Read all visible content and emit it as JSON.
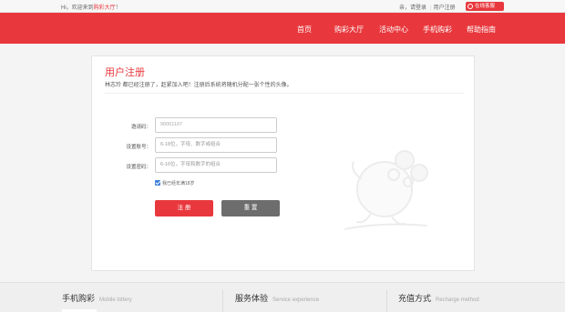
{
  "topbar": {
    "welcome": "Hi，欢迎来到",
    "hall_link": "购彩大厅",
    "welcome_end": "！",
    "login_prefix": "亲，请登录",
    "register": "用户注册",
    "service": "在线客服"
  },
  "nav": {
    "items": [
      "首页",
      "购彩大厅",
      "活动中心",
      "手机购彩",
      "帮助指南"
    ]
  },
  "panel": {
    "title": "用户注册",
    "subtitle": "林志玲 都已经注册了，赶紧加入吧！注册后系统将随机分配一张个性的头像。"
  },
  "form": {
    "invite_label": "邀请码：",
    "invite_value": "90001107",
    "account_label": "设置账号：",
    "account_placeholder": "6-18位，字母、数字或组合",
    "password_label": "设置密码：",
    "password_placeholder": "6-16位，字母和数字的组合",
    "agree_text": "我已经年满18岁",
    "register_btn": "注 册",
    "reset_btn": "重 置"
  },
  "footer": {
    "cols": [
      {
        "title": "手机购彩",
        "en": "Mobile lottery"
      },
      {
        "title": "服务体验",
        "en": "Service experience"
      },
      {
        "title": "充值方式",
        "en": "Recharge method"
      }
    ]
  },
  "colors": {
    "brand": "#e8383d",
    "checkbox": "#3b7dd8"
  }
}
